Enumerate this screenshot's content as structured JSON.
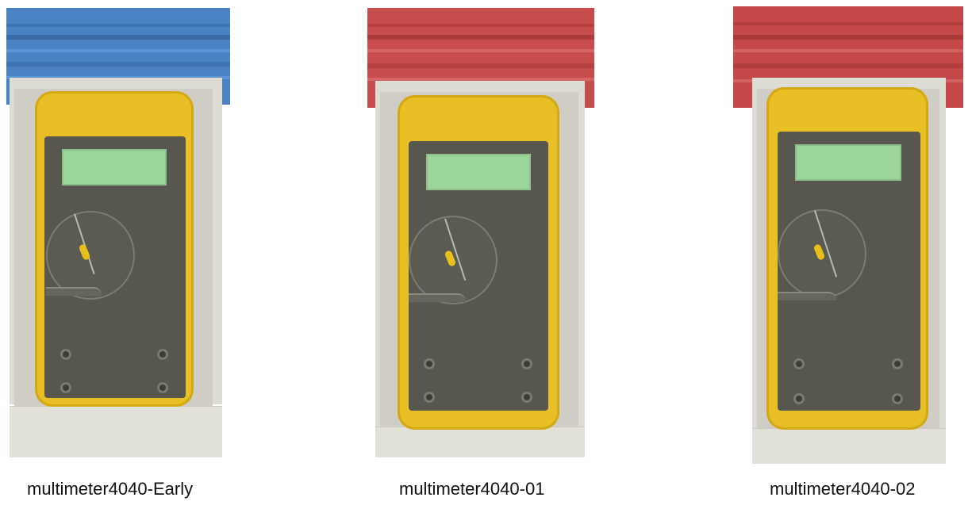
{
  "captions": {
    "early": "multimeter4040-Early",
    "v01": "multimeter4040-01",
    "v02": "multimeter4040-02"
  },
  "colors": {
    "rail_early": "#4a82c4",
    "rail_01": "#c74d4d",
    "rail_02": "#c44848",
    "multimeter_case": "#e8bf24",
    "faceplate": "#57574f",
    "screen": "#9bd59a",
    "holder": "#dcdbd4"
  },
  "icons": [
    "multimeter-icon"
  ]
}
